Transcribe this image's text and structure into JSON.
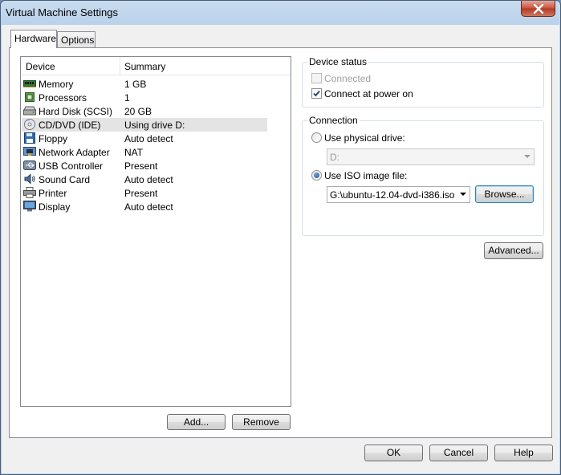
{
  "window": {
    "title": "Virtual Machine Settings"
  },
  "tabs": [
    {
      "label": "Hardware"
    },
    {
      "label": "Options"
    }
  ],
  "device_list": {
    "columns": [
      "Device",
      "Summary"
    ],
    "rows": [
      {
        "icon": "memory-icon",
        "device": "Memory",
        "summary": "1 GB"
      },
      {
        "icon": "processor-icon",
        "device": "Processors",
        "summary": "1"
      },
      {
        "icon": "hard-disk-icon",
        "device": "Hard Disk (SCSI)",
        "summary": "20 GB"
      },
      {
        "icon": "cd-dvd-icon",
        "device": "CD/DVD (IDE)",
        "summary": "Using drive D:",
        "selected": true
      },
      {
        "icon": "floppy-icon",
        "device": "Floppy",
        "summary": "Auto detect"
      },
      {
        "icon": "network-icon",
        "device": "Network Adapter",
        "summary": "NAT"
      },
      {
        "icon": "usb-icon",
        "device": "USB Controller",
        "summary": "Present"
      },
      {
        "icon": "sound-icon",
        "device": "Sound Card",
        "summary": "Auto detect"
      },
      {
        "icon": "printer-icon",
        "device": "Printer",
        "summary": "Present"
      },
      {
        "icon": "display-icon",
        "device": "Display",
        "summary": "Auto detect"
      }
    ]
  },
  "list_buttons": {
    "add": "Add...",
    "remove": "Remove"
  },
  "device_status": {
    "title": "Device status",
    "connected": {
      "label": "Connected",
      "checked": false,
      "disabled": true
    },
    "connect_power_on": {
      "label": "Connect at power on",
      "checked": true
    }
  },
  "connection": {
    "title": "Connection",
    "physical": {
      "label": "Use physical drive:",
      "selected": false,
      "drive": "D:"
    },
    "iso": {
      "label": "Use ISO image file:",
      "selected": true,
      "path": "G:\\ubuntu-12.04-dvd-i386.iso",
      "browse": "Browse..."
    }
  },
  "advanced_button": "Advanced...",
  "footer": {
    "ok": "OK",
    "cancel": "Cancel",
    "help": "Help"
  }
}
